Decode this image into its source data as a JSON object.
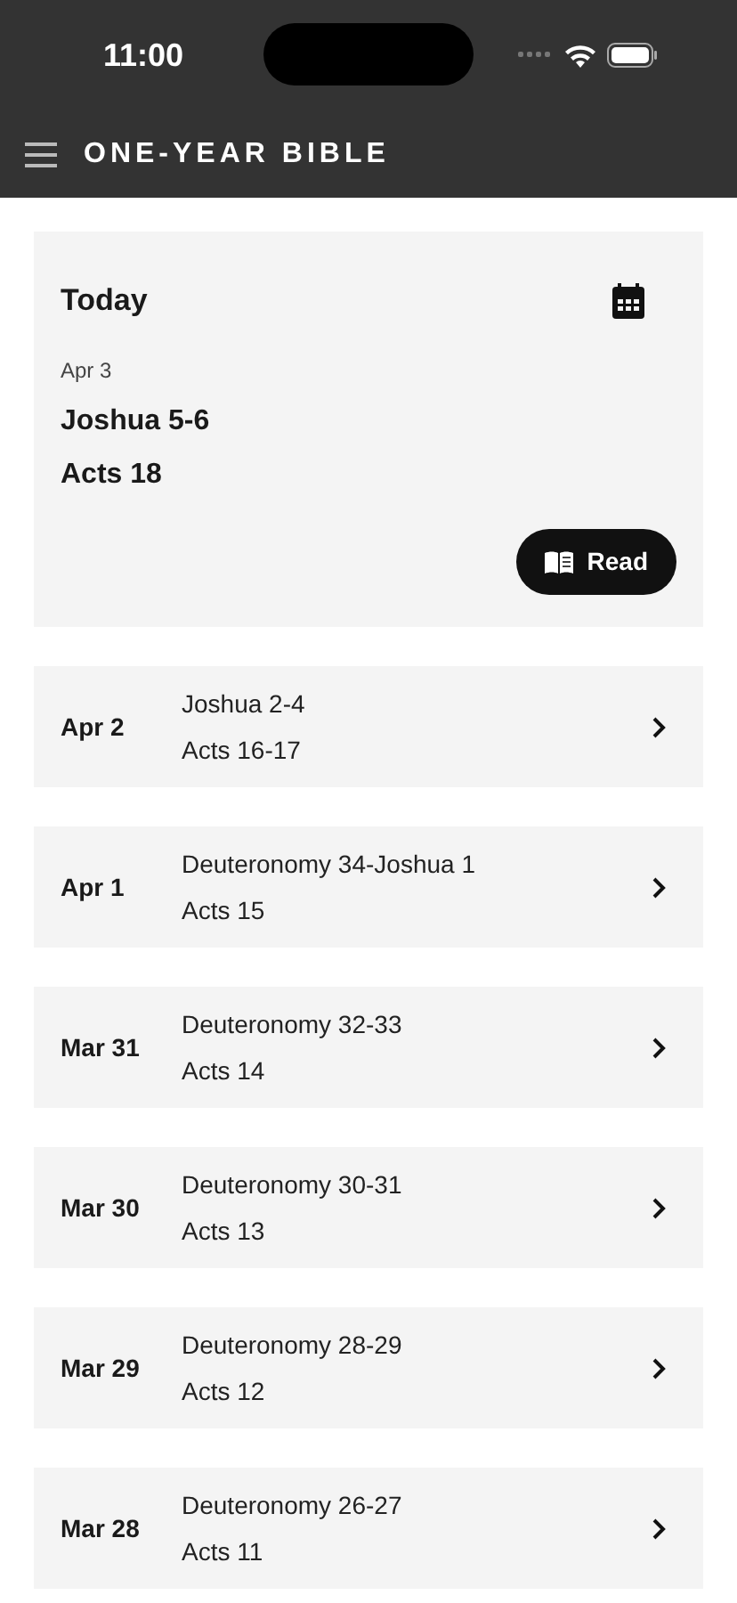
{
  "status_bar": {
    "time": "11:00"
  },
  "header": {
    "title": "ONE-YEAR BIBLE"
  },
  "today": {
    "heading": "Today",
    "date": "Apr 3",
    "readings": [
      "Joshua 5-6",
      "Acts 18"
    ],
    "button": "Read"
  },
  "days": [
    {
      "date": "Apr 2",
      "readings": [
        "Joshua 2-4",
        "Acts 16-17"
      ]
    },
    {
      "date": "Apr 1",
      "readings": [
        "Deuteronomy 34-Joshua 1",
        "Acts 15"
      ]
    },
    {
      "date": "Mar 31",
      "readings": [
        "Deuteronomy 32-33",
        "Acts 14"
      ]
    },
    {
      "date": "Mar 30",
      "readings": [
        "Deuteronomy 30-31",
        "Acts 13"
      ]
    },
    {
      "date": "Mar 29",
      "readings": [
        "Deuteronomy 28-29",
        "Acts 12"
      ]
    },
    {
      "date": "Mar 28",
      "readings": [
        "Deuteronomy 26-27",
        "Acts 11"
      ]
    }
  ]
}
